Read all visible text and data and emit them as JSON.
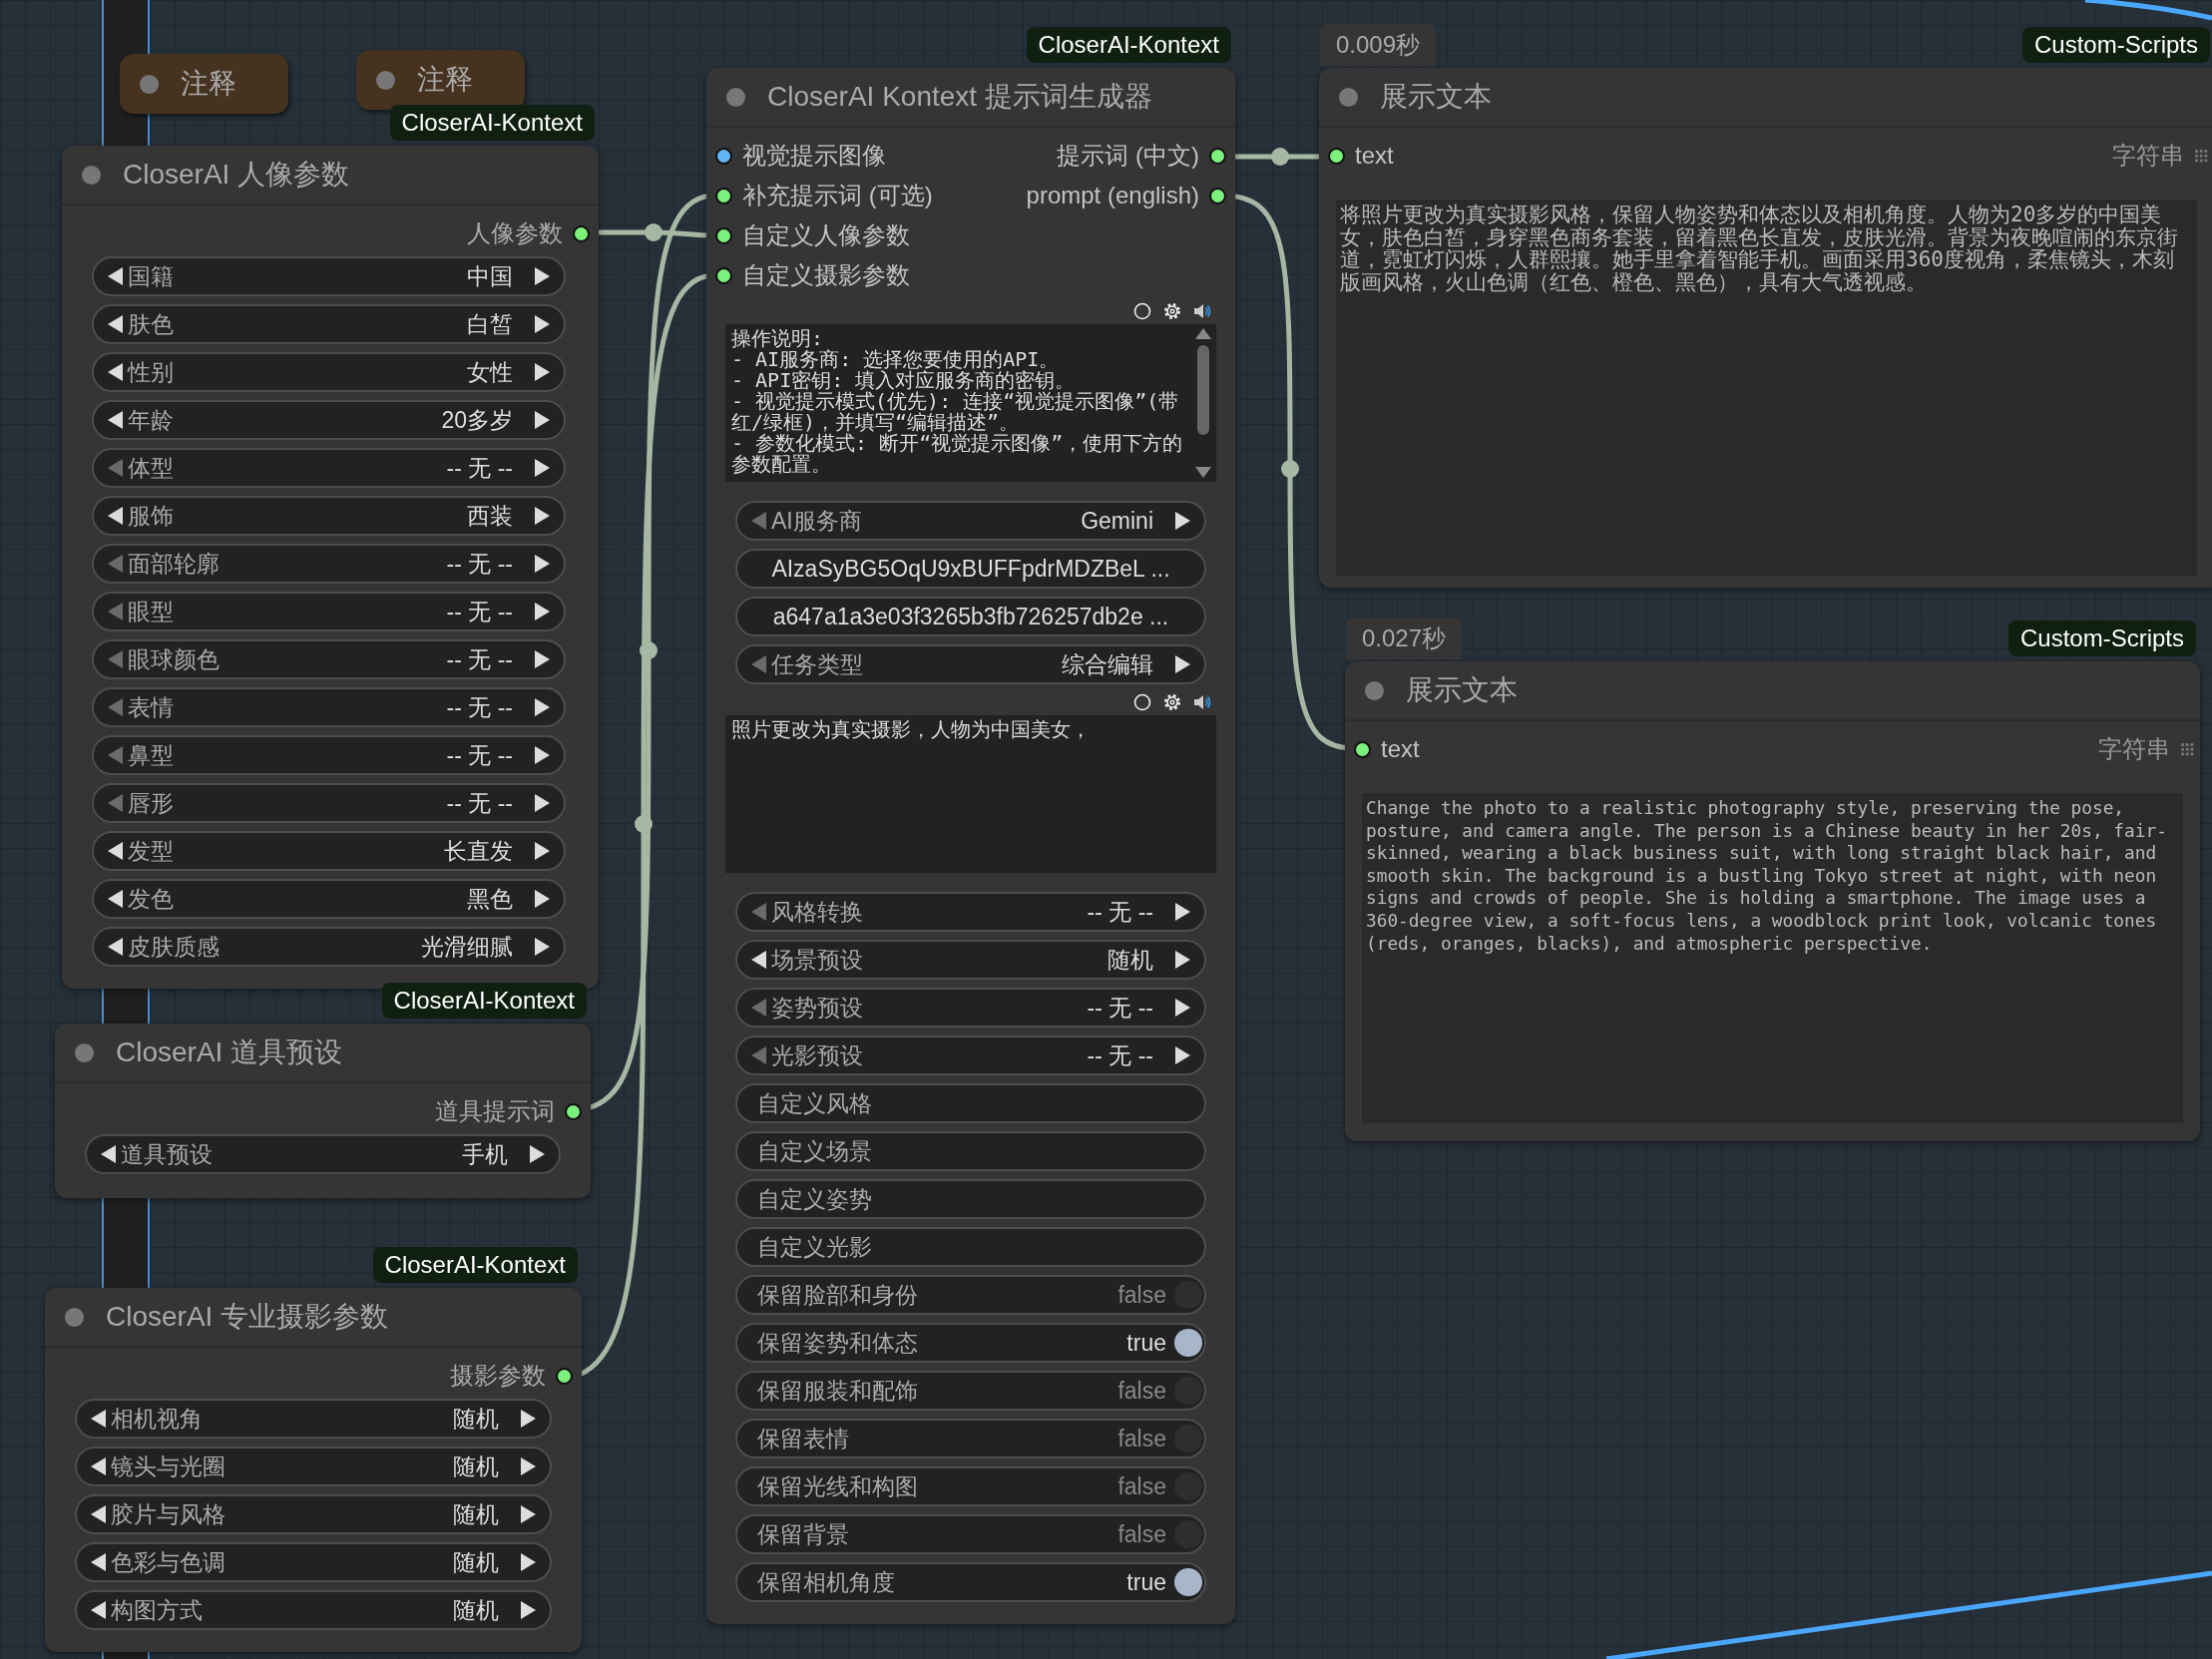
{
  "notes": [
    {
      "title": "注释"
    },
    {
      "title": "注释"
    }
  ],
  "nodes": [
    {
      "badge": "CloserAI-Kontext",
      "title": "CloserAI 人像参数",
      "outputs": [
        {
          "label": "人像参数",
          "color": "#7cf07c"
        }
      ],
      "widgets": [
        {
          "kind": "combo",
          "label": "国籍",
          "value": "中国",
          "prev_disabled": false
        },
        {
          "kind": "combo",
          "label": "肤色",
          "value": "白皙",
          "prev_disabled": false
        },
        {
          "kind": "combo",
          "label": "性别",
          "value": "女性",
          "prev_disabled": false
        },
        {
          "kind": "combo",
          "label": "年龄",
          "value": "20多岁",
          "prev_disabled": false
        },
        {
          "kind": "combo",
          "label": "体型",
          "value": "-- 无 --",
          "prev_disabled": true
        },
        {
          "kind": "combo",
          "label": "服饰",
          "value": "西装",
          "prev_disabled": false
        },
        {
          "kind": "combo",
          "label": "面部轮廓",
          "value": "-- 无 --",
          "prev_disabled": true
        },
        {
          "kind": "combo",
          "label": "眼型",
          "value": "-- 无 --",
          "prev_disabled": true
        },
        {
          "kind": "combo",
          "label": "眼球颜色",
          "value": "-- 无 --",
          "prev_disabled": true
        },
        {
          "kind": "combo",
          "label": "表情",
          "value": "-- 无 --",
          "prev_disabled": true
        },
        {
          "kind": "combo",
          "label": "鼻型",
          "value": "-- 无 --",
          "prev_disabled": true
        },
        {
          "kind": "combo",
          "label": "唇形",
          "value": "-- 无 --",
          "prev_disabled": true
        },
        {
          "kind": "combo",
          "label": "发型",
          "value": "长直发",
          "prev_disabled": false
        },
        {
          "kind": "combo",
          "label": "发色",
          "value": "黑色",
          "prev_disabled": false
        },
        {
          "kind": "combo",
          "label": "皮肤质感",
          "value": "光滑细腻",
          "prev_disabled": false
        }
      ]
    },
    {
      "badge": "CloserAI-Kontext",
      "title": "CloserAI 道具预设",
      "outputs": [
        {
          "label": "道具提示词",
          "color": "#7cf07c"
        }
      ],
      "widgets": [
        {
          "kind": "combo",
          "label": "道具预设",
          "value": "手机",
          "prev_disabled": false
        }
      ]
    },
    {
      "badge": "CloserAI-Kontext",
      "title": "CloserAI 专业摄影参数",
      "outputs": [
        {
          "label": "摄影参数",
          "color": "#7cf07c"
        }
      ],
      "widgets": [
        {
          "kind": "combo",
          "label": "相机视角",
          "value": "随机",
          "prev_disabled": false
        },
        {
          "kind": "combo",
          "label": "镜头与光圈",
          "value": "随机",
          "prev_disabled": false
        },
        {
          "kind": "combo",
          "label": "胶片与风格",
          "value": "随机",
          "prev_disabled": false
        },
        {
          "kind": "combo",
          "label": "色彩与色调",
          "value": "随机",
          "prev_disabled": false
        },
        {
          "kind": "combo",
          "label": "构图方式",
          "value": "随机",
          "prev_disabled": false
        }
      ]
    },
    {
      "badge": "CloserAI-Kontext",
      "title": "CloserAI Kontext 提示词生成器",
      "inputs": [
        {
          "label": "视觉提示图像",
          "color": "#64b5f6"
        },
        {
          "label": "补充提示词 (可选)",
          "color": "#7cf07c"
        },
        {
          "label": "自定义人像参数",
          "color": "#7cf07c"
        },
        {
          "label": "自定义摄影参数",
          "color": "#7cf07c"
        }
      ],
      "outputs": [
        {
          "label": "提示词 (中文)",
          "color": "#7cf07c"
        },
        {
          "label": "prompt (english)",
          "color": "#7cf07c"
        }
      ],
      "widgets": [
        {
          "kind": "textarea",
          "scrollbar": true,
          "value": "操作说明:\n- AI服务商: 选择您要使用的API。\n- API密钥: 填入对应服务商的密钥。\n- 视觉提示模式(优先): 连接“视觉提示图像”(带红/绿框)，并填写“编辑描述”。\n- 参数化模式: 断开“视觉提示图像”，使用下方的参数配置。"
        },
        {
          "kind": "combo",
          "label": "AI服务商",
          "value": "Gemini",
          "prev_disabled": true
        },
        {
          "kind": "string",
          "value": "AIzaSyBG5OqU9xBUFFpdrMDZBeL ..."
        },
        {
          "kind": "string",
          "value": "a647a1a3e03f3265b3fb726257db2e ..."
        },
        {
          "kind": "combo",
          "label": "任务类型",
          "value": "综合编辑",
          "prev_disabled": true
        },
        {
          "kind": "textarea",
          "scrollbar": false,
          "value": "照片更改为真实摄影，人物为中国美女，"
        },
        {
          "kind": "combo",
          "label": "风格转换",
          "value": "-- 无 --",
          "prev_disabled": true
        },
        {
          "kind": "combo",
          "label": "场景预设",
          "value": "随机",
          "prev_disabled": false
        },
        {
          "kind": "combo",
          "label": "姿势预设",
          "value": "-- 无 --",
          "prev_disabled": true
        },
        {
          "kind": "combo",
          "label": "光影预设",
          "value": "-- 无 --",
          "prev_disabled": true
        },
        {
          "kind": "text",
          "label": "自定义风格"
        },
        {
          "kind": "text",
          "label": "自定义场景"
        },
        {
          "kind": "text",
          "label": "自定义姿势"
        },
        {
          "kind": "text",
          "label": "自定义光影"
        },
        {
          "kind": "toggle",
          "label": "保留脸部和身份",
          "value": "false",
          "on": false
        },
        {
          "kind": "toggle",
          "label": "保留姿势和体态",
          "value": "true",
          "on": true
        },
        {
          "kind": "toggle",
          "label": "保留服装和配饰",
          "value": "false",
          "on": false
        },
        {
          "kind": "toggle",
          "label": "保留表情",
          "value": "false",
          "on": false
        },
        {
          "kind": "toggle",
          "label": "保留光线和构图",
          "value": "false",
          "on": false
        },
        {
          "kind": "toggle",
          "label": "保留背景",
          "value": "false",
          "on": false
        },
        {
          "kind": "toggle",
          "label": "保留相机角度",
          "value": "true",
          "on": true
        }
      ]
    },
    {
      "time": "0.009秒",
      "badge": "Custom-Scripts",
      "title": "展示文本",
      "inputs": [
        {
          "label": "text",
          "type": "字符串",
          "color": "#7cf07c"
        }
      ],
      "widgets": [
        {
          "kind": "display",
          "value": "将照片更改为真实摄影风格，保留人物姿势和体态以及相机角度。人物为20多岁的中国美女，肤色白皙，身穿黑色商务套装，留着黑色长直发，皮肤光滑。背景为夜晚喧闹的东京街道，霓虹灯闪烁，人群熙攘。她手里拿着智能手机。画面采用360度视角，柔焦镜头，木刻版画风格，火山色调（红色、橙色、黑色），具有大气透视感。"
        }
      ]
    },
    {
      "time": "0.027秒",
      "badge": "Custom-Scripts",
      "title": "展示文本",
      "inputs": [
        {
          "label": "text",
          "type": "字符串",
          "color": "#7cf07c"
        }
      ],
      "widgets": [
        {
          "kind": "display",
          "value": "Change the photo to a realistic photography style, preserving the pose, posture, and camera angle. The person is a Chinese beauty in her 20s, fair-skinned, wearing a black business suit, with long straight black hair, and smooth skin. The background is a bustling Tokyo street at night, with neon signs and crowds of people. She is holding a smartphone. The image uses a 360-degree view, a soft-focus lens, a woodblock print look, volcanic tones (reds, oranges, blacks), and atmospheric perspective."
        }
      ]
    }
  ]
}
